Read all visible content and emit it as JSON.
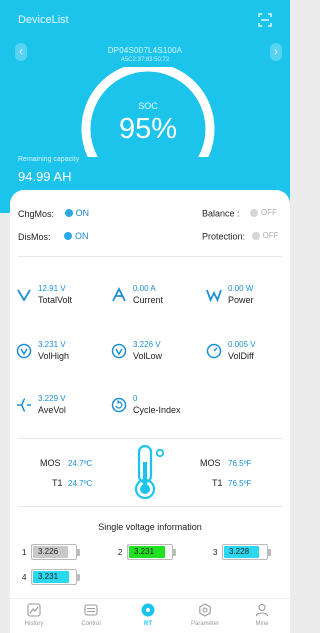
{
  "header": {
    "title": "DeviceList",
    "device_name": "DP04S007L4S100A",
    "device_mac": "A5C2:37:83:50:72",
    "soc_label": "SOC",
    "soc_value": "95%",
    "soc_level": 0.95,
    "remaining_label": "Remaining capacity",
    "remaining_value": "94.99 AH",
    "accent_color": "#1cc4ec"
  },
  "switches": {
    "chg_label": "ChgMos:",
    "chg_state": "ON",
    "dis_label": "DisMos:",
    "dis_state": "ON",
    "balance_label": "Balance :",
    "balance_state": "OFF",
    "protection_label": "Protection:",
    "protection_state": "OFF"
  },
  "metrics": [
    {
      "icon": "voltage-icon",
      "value": "12.91 V",
      "label": "TotalVolt"
    },
    {
      "icon": "current-icon",
      "value": "0.00 A",
      "label": "Current"
    },
    {
      "icon": "power-icon",
      "value": "0.00 W",
      "label": "Power"
    },
    {
      "icon": "voltage-high-icon",
      "value": "3.231 V",
      "label": "VolHigh"
    },
    {
      "icon": "voltage-low-icon",
      "value": "3.226 V",
      "label": "VolLow"
    },
    {
      "icon": "voltage-diff-icon",
      "value": "0.005 V",
      "label": "VolDiff"
    },
    {
      "icon": "average-voltage-icon",
      "value": "3.229 V",
      "label": "AveVol"
    },
    {
      "icon": "cycle-icon",
      "value": "0",
      "label": "Cycle-Index"
    }
  ],
  "temperature": {
    "left_mos_label": "MOS",
    "left_mos_value": "24.7ºC",
    "left_t1_label": "T1",
    "left_t1_value": "24.7ºC",
    "right_mos_label": "MOS",
    "right_mos_value": "76.5ºF",
    "right_t1_label": "T1",
    "right_t1_value": "76.5ºF"
  },
  "cells": {
    "title": "Single voltage information",
    "items": [
      {
        "index": "1",
        "value": "3.226",
        "color": "#c8c8c8"
      },
      {
        "index": "2",
        "value": "3.231",
        "color": "#22e022"
      },
      {
        "index": "3",
        "value": "3.228",
        "color": "#2ad8f0"
      },
      {
        "index": "4",
        "value": "3.231",
        "color": "#2ad8f0"
      }
    ]
  },
  "tabs": [
    {
      "label": "History",
      "icon": "chart-icon"
    },
    {
      "label": "Control",
      "icon": "control-icon"
    },
    {
      "label": "RT",
      "icon": "realtime-icon",
      "active": true
    },
    {
      "label": "Parameter",
      "icon": "parameter-icon"
    },
    {
      "label": "Mine",
      "icon": "user-icon"
    }
  ]
}
